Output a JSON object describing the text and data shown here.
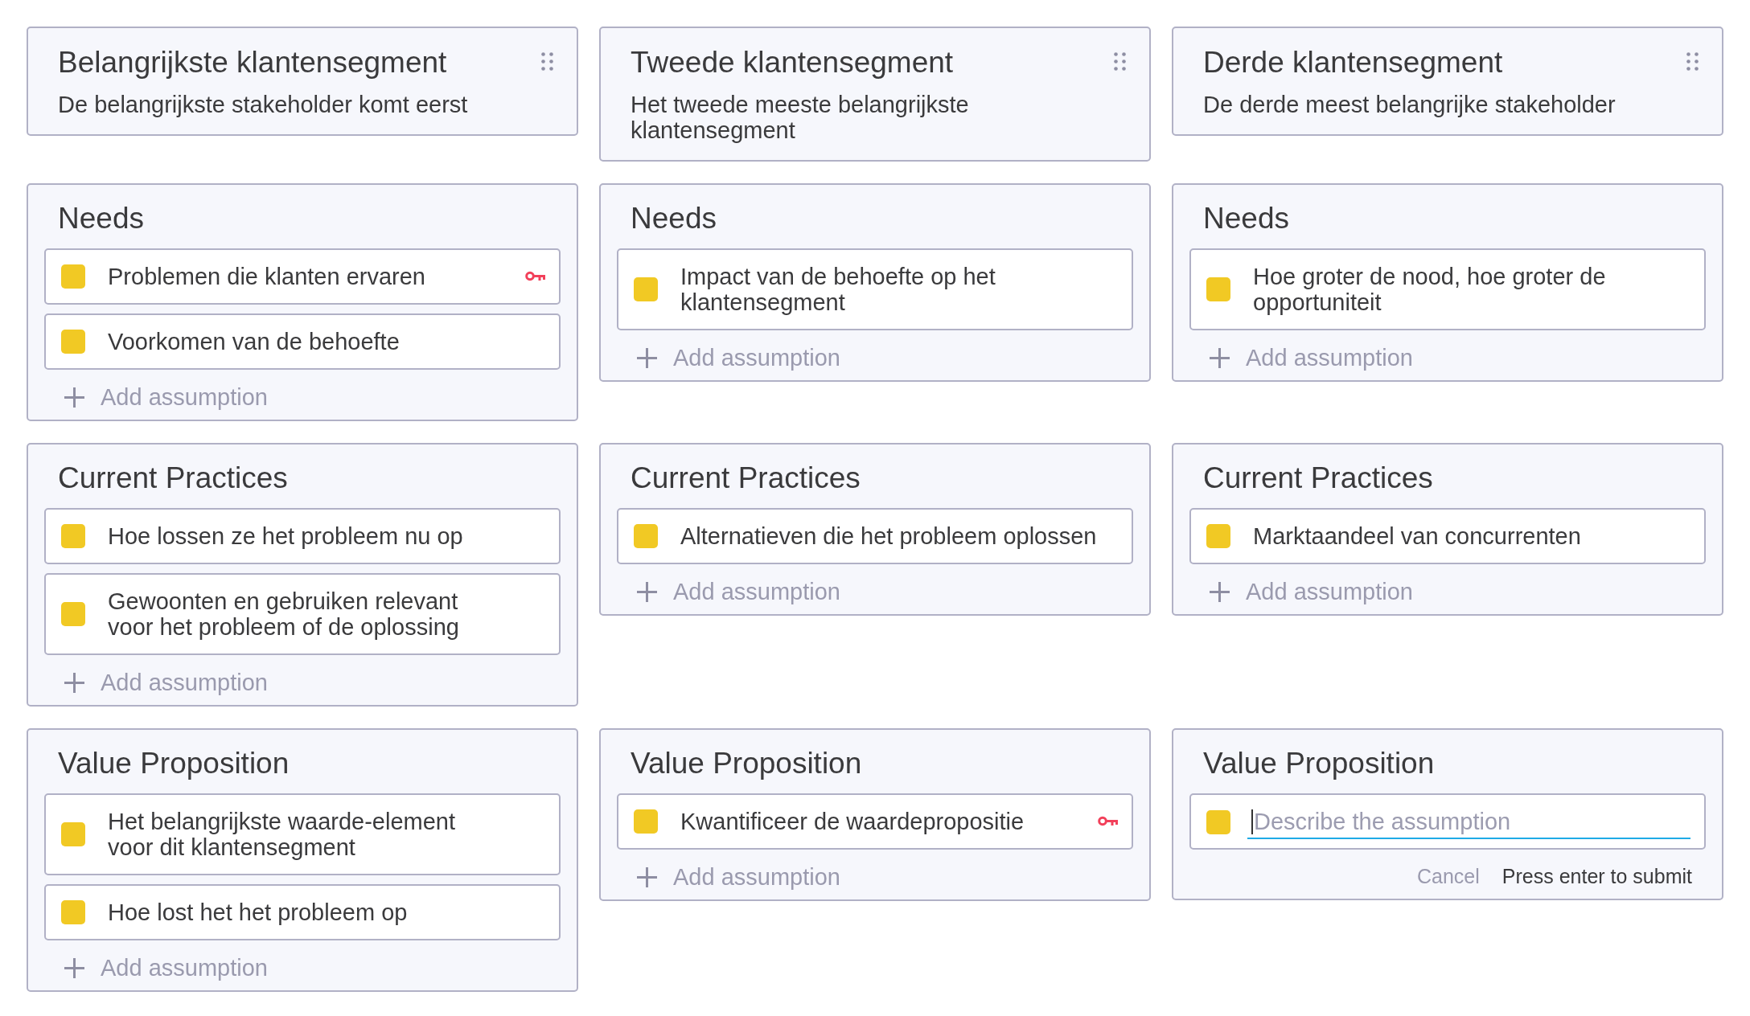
{
  "segments": [
    {
      "title": "Belangrijkste klantensegment",
      "description": "De belangrijkste stakeholder komt eerst",
      "sections": [
        {
          "title": "Needs",
          "assumptions": [
            {
              "text": "Problemen die klanten ervaren",
              "key": true
            },
            {
              "text": "Voorkomen van de behoefte",
              "key": false
            }
          ],
          "add_label": "Add assumption"
        },
        {
          "title": "Current Practices",
          "assumptions": [
            {
              "text": "Hoe lossen ze het probleem nu op",
              "key": false
            },
            {
              "text": "Gewoonten en gebruiken relevant\nvoor het probleem of de oplossing",
              "key": false
            }
          ],
          "add_label": "Add assumption"
        },
        {
          "title": "Value Proposition",
          "assumptions": [
            {
              "text": "Het belangrijkste waarde-element\nvoor dit klantensegment",
              "key": false
            },
            {
              "text": "Hoe lost het het probleem op",
              "key": false
            }
          ],
          "add_label": "Add assumption"
        }
      ]
    },
    {
      "title": "Tweede klantensegment",
      "description": "Het tweede meeste belangrijkste\nklantensegment",
      "sections": [
        {
          "title": "Needs",
          "assumptions": [
            {
              "text": "Impact van de behoefte op het\nklantensegment",
              "key": false
            }
          ],
          "add_label": "Add assumption"
        },
        {
          "title": "Current Practices",
          "assumptions": [
            {
              "text": "Alternatieven die het probleem oplossen",
              "key": false
            }
          ],
          "add_label": "Add assumption"
        },
        {
          "title": "Value Proposition",
          "assumptions": [
            {
              "text": "Kwantificeer de waardepropositie",
              "key": true
            }
          ],
          "add_label": "Add assumption"
        }
      ]
    },
    {
      "title": "Derde klantensegment",
      "description": "De derde meest belangrijke stakeholder",
      "sections": [
        {
          "title": "Needs",
          "assumptions": [
            {
              "text": "Hoe groter de nood, hoe groter de\nopportuniteit",
              "key": false
            }
          ],
          "add_label": "Add assumption"
        },
        {
          "title": "Current Practices",
          "assumptions": [
            {
              "text": "Marktaandeel van concurrenten",
              "key": false
            }
          ],
          "add_label": "Add assumption"
        },
        {
          "title": "Value Proposition",
          "new_assumption": {
            "placeholder": "Describe the assumption",
            "focused": true,
            "cancel": "Cancel",
            "hint": "Press enter to submit"
          }
        }
      ]
    }
  ]
}
